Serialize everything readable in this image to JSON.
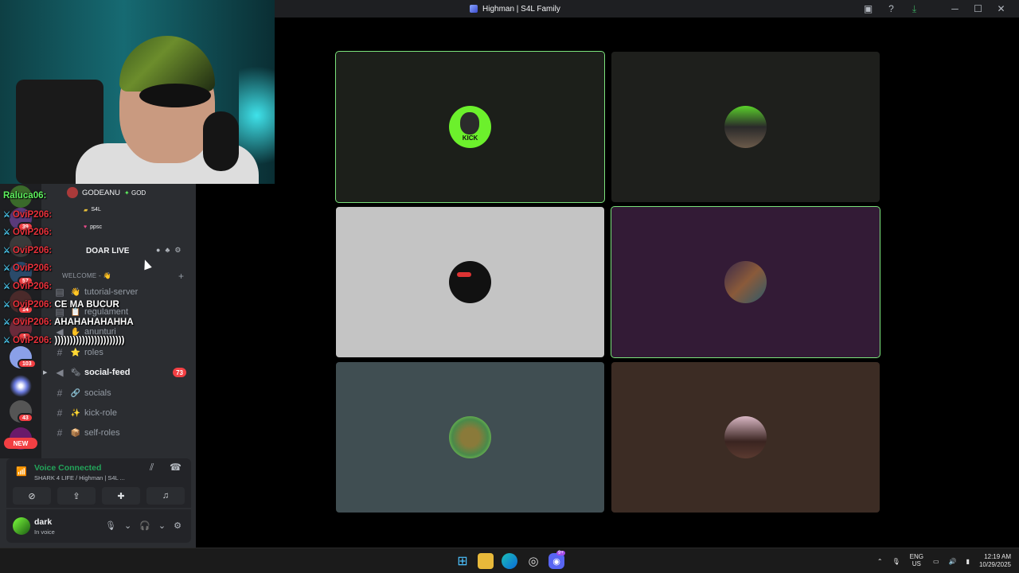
{
  "window": {
    "title": "Highman | S4L Family"
  },
  "stage": {
    "tiles": [
      {
        "bg": "#1c1f1a",
        "speaking": true,
        "avatar_label": "KICK"
      },
      {
        "bg": "#1e1f1c",
        "speaking": false,
        "avatar_label": ""
      },
      {
        "bg": "#c4c4c4",
        "speaking": false,
        "avatar_label": ""
      },
      {
        "bg": "#331b36",
        "speaking": true,
        "avatar_label": ""
      },
      {
        "bg": "#404e52",
        "speaking": false,
        "avatar_label": ""
      },
      {
        "bg": "#3c2c24",
        "speaking": false,
        "avatar_label": ""
      }
    ]
  },
  "chat_overlay": {
    "lines": [
      {
        "user": "Raluca06:",
        "msg": "",
        "green": true
      },
      {
        "user": "OviP206:",
        "msg": ""
      },
      {
        "user": "OviP206:",
        "msg": ""
      },
      {
        "user": "OviP206:",
        "msg": ""
      },
      {
        "user": "OviP206:",
        "msg": ""
      },
      {
        "user": "OviP206:",
        "msg": ""
      },
      {
        "user": "OviP206:",
        "msg": "CE MA BUCUR"
      },
      {
        "user": "OviP206:",
        "msg": "AHAHAHAHAHHA"
      },
      {
        "user": "OviP206:",
        "msg": ")))))))))))))))))))))))"
      }
    ]
  },
  "voice_members": {
    "header_name": "GODEANU",
    "header_tag": "GOD",
    "row1_tag": "S4L",
    "row2_tag": "ppsc",
    "live_label": "DOAR LIVE"
  },
  "channels": {
    "category": "WELCOME - 👋",
    "items": [
      {
        "emoji": "👋",
        "name": "tutorial-server",
        "unread": false
      },
      {
        "emoji": "📋",
        "name": "regulament",
        "unread": false
      },
      {
        "emoji": "✋",
        "name": "anunturi",
        "unread": false
      },
      {
        "emoji": "⭐",
        "name": "roles",
        "unread": false
      },
      {
        "emoji": "🗞",
        "name": "social-feed",
        "unread": true,
        "badge": "73"
      },
      {
        "emoji": "🔗",
        "name": "socials",
        "unread": false
      },
      {
        "emoji": "✨",
        "name": "kick-role",
        "unread": false
      },
      {
        "emoji": "📦",
        "name": "self-roles",
        "unread": false
      }
    ]
  },
  "server_badges": {
    "b1": "39",
    "b2": "57",
    "b3": "14",
    "b4": "1",
    "b5": "103",
    "b6": "43",
    "new": "NEW"
  },
  "voice_panel": {
    "status": "Voice Connected",
    "location": "SHARK 4 LIFE / Highman | S4L ..."
  },
  "user_panel": {
    "name": "dark",
    "status": "In voice"
  },
  "taskbar": {
    "lang_top": "ENG",
    "lang_bottom": "US",
    "time": "12:19 AM",
    "date": "10/29/2025",
    "discord_badge": "9+"
  }
}
